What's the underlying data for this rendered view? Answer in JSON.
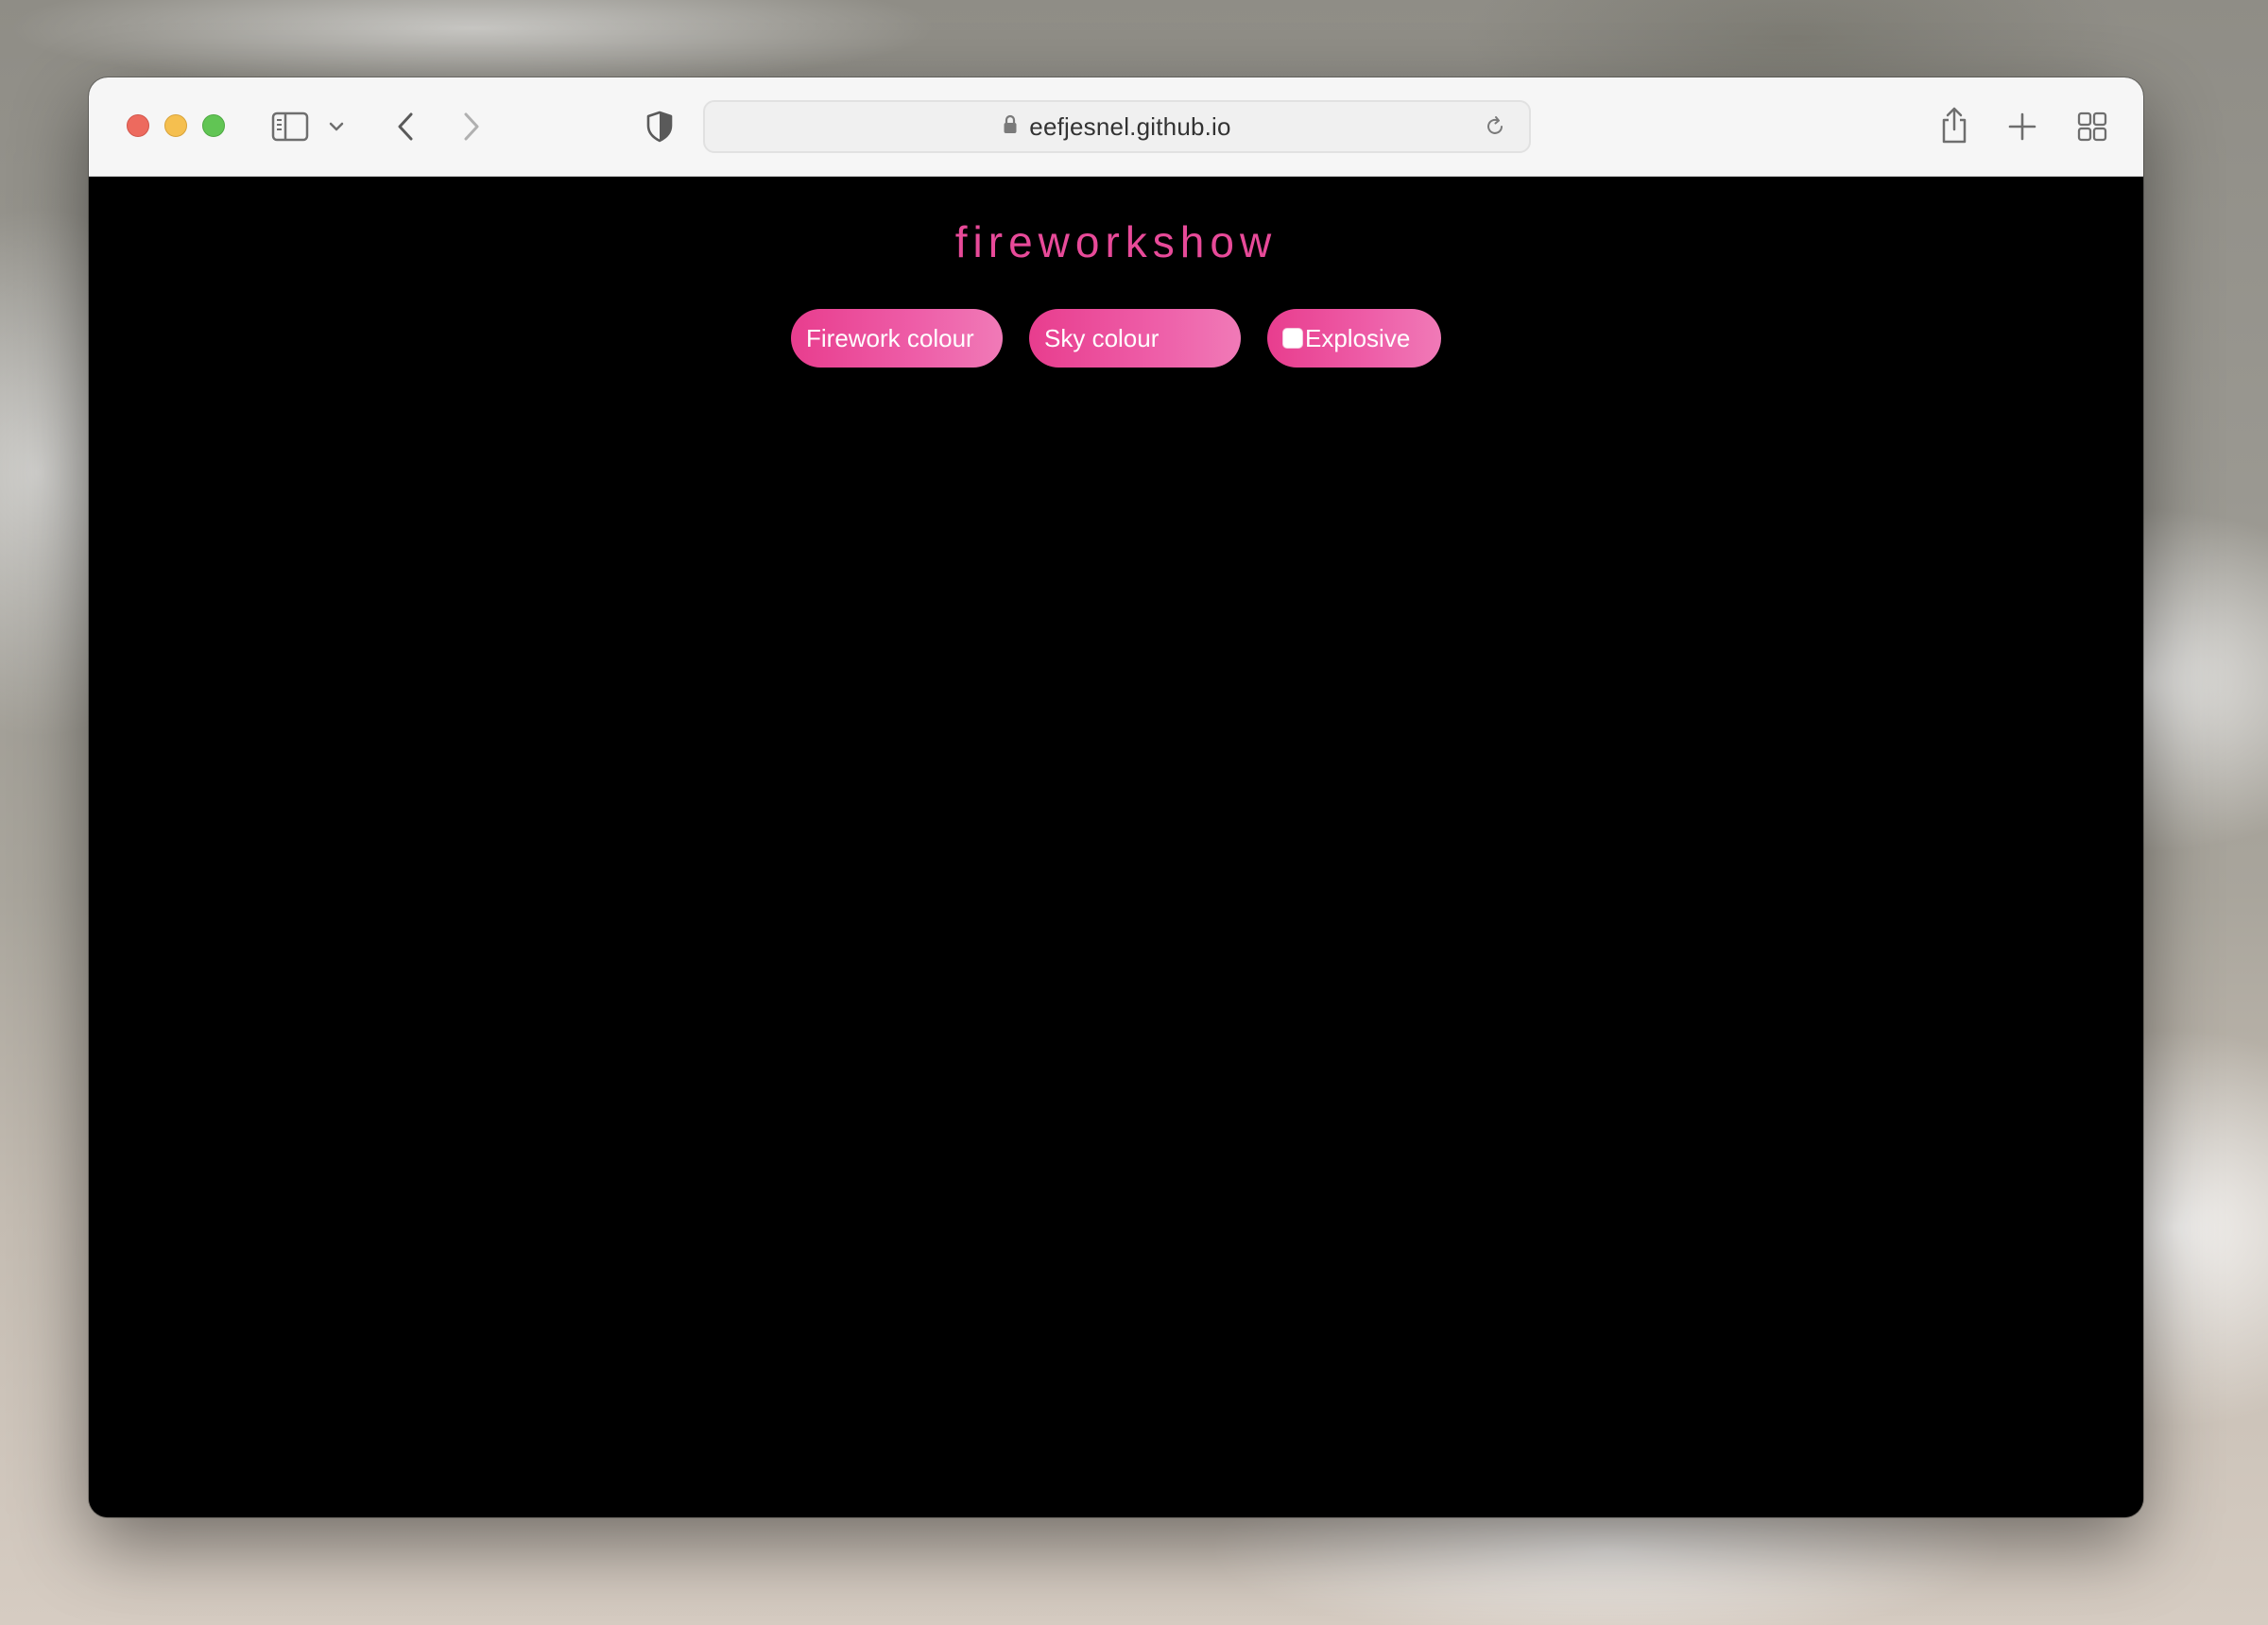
{
  "browser": {
    "url": "eefjesnel.github.io",
    "buttons": {
      "close": "close",
      "minimize": "minimize",
      "zoom": "zoom"
    },
    "icons": {
      "sidebar": "sidebar-icon",
      "chevron": "chevron-down-icon",
      "back": "back-arrow-icon",
      "forward": "forward-arrow-icon",
      "privacy": "shield-icon",
      "lock": "lock-icon",
      "reload": "reload-icon",
      "share": "share-icon",
      "new_tab": "plus-icon",
      "tab_overview": "grid-icon"
    }
  },
  "page": {
    "title": "fireworkshow",
    "controls": {
      "firework_colour": "Firework colour",
      "sky_colour": "Sky colour",
      "explosive": "Explosive",
      "explosive_checked": false
    },
    "colors": {
      "accent": "#e84a99",
      "background": "#000000"
    }
  }
}
